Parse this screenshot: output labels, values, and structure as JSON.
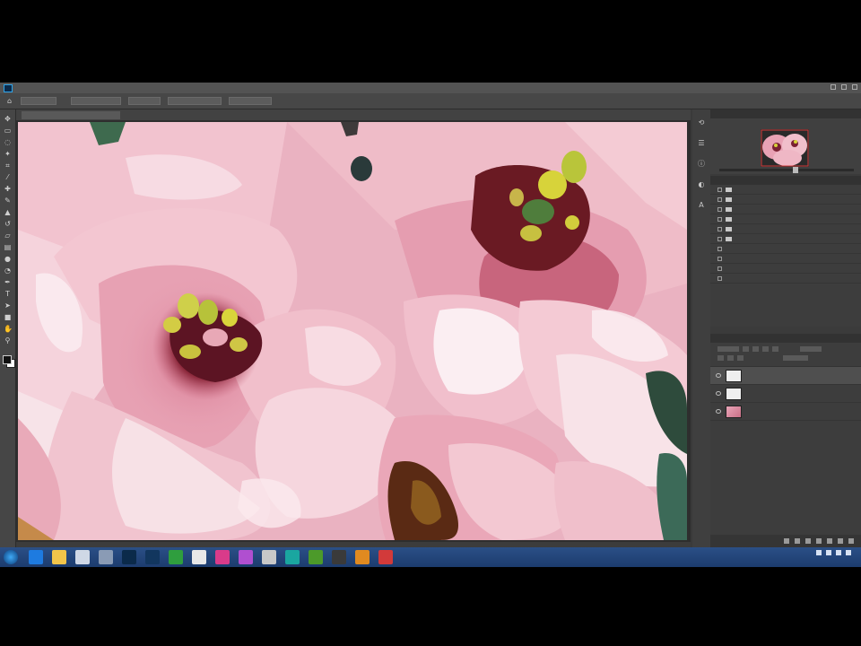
{
  "app": {
    "name": "Photoshop",
    "brand_color": "#2fa3e6"
  },
  "menubar": {
    "logo": "photoshop-logo-icon",
    "items": [
      "",
      "",
      "",
      "",
      "",
      "",
      "",
      "",
      "",
      "",
      ""
    ]
  },
  "options_bar": {
    "chips": [
      "",
      "",
      "",
      ""
    ]
  },
  "document": {
    "tab_label": ""
  },
  "tools": [
    "move-icon",
    "marquee-icon",
    "lasso-icon",
    "wand-icon",
    "crop-icon",
    "eyedropper-icon",
    "heal-icon",
    "brush-icon",
    "stamp-icon",
    "history-brush-icon",
    "eraser-icon",
    "gradient-icon",
    "blur-icon",
    "dodge-icon",
    "pen-icon",
    "type-icon",
    "path-select-icon",
    "shape-icon",
    "hand-icon",
    "zoom-icon"
  ],
  "canvas": {
    "subject": "painterly pink flower close-up",
    "colors": {
      "pink_light": "#f3c9d3",
      "pink_mid": "#e9a2b5",
      "pink_deep": "#c8657d",
      "stamen_yellow": "#d7d33a",
      "center_dark": "#6a1a23",
      "leaf_green": "#3e6a4e"
    }
  },
  "status": {
    "text": ""
  },
  "right_strip": [
    "history-icon",
    "properties-icon",
    "info-icon",
    "adjustments-icon",
    "character-icon"
  ],
  "navigator": {
    "tabs": [
      "",
      ""
    ],
    "zoom": ""
  },
  "actions": {
    "tabs": [
      "",
      ""
    ],
    "rows": [
      "",
      "",
      "",
      "",
      "",
      "",
      "",
      "",
      "",
      ""
    ]
  },
  "layers": {
    "tabs": [
      "",
      "",
      ""
    ],
    "items": [
      {
        "name": "",
        "thumb": "white"
      },
      {
        "name": "",
        "thumb": "white"
      },
      {
        "name": "",
        "thumb": "photo"
      }
    ]
  },
  "taskbar": {
    "icons": [
      {
        "name": "ie-icon",
        "color": "#1e7be0"
      },
      {
        "name": "folder-icon",
        "color": "#f2c54a"
      },
      {
        "name": "files-icon",
        "color": "#cfd8e6"
      },
      {
        "name": "app-icon-1",
        "color": "#8a9bb5"
      },
      {
        "name": "photoshop-task-icon",
        "color": "#0b2a4a"
      },
      {
        "name": "photoshop-task-icon-2",
        "color": "#12365e"
      },
      {
        "name": "green-app-icon",
        "color": "#2f9e3e"
      },
      {
        "name": "chrome-like-icon",
        "color": "#e8e8e8"
      },
      {
        "name": "pink-app-icon",
        "color": "#d93b8a"
      },
      {
        "name": "purple-app-icon",
        "color": "#b04fd0"
      },
      {
        "name": "doc-icon",
        "color": "#c8c8c8"
      },
      {
        "name": "teal-app-icon",
        "color": "#1aa6a0"
      },
      {
        "name": "leaf-app-icon",
        "color": "#4c9a2a"
      },
      {
        "name": "camera-icon",
        "color": "#3a3a3a"
      },
      {
        "name": "orange-app-icon",
        "color": "#e08a20"
      },
      {
        "name": "red-app-icon",
        "color": "#d23a3a"
      }
    ],
    "clock_time": "",
    "clock_date": ""
  }
}
